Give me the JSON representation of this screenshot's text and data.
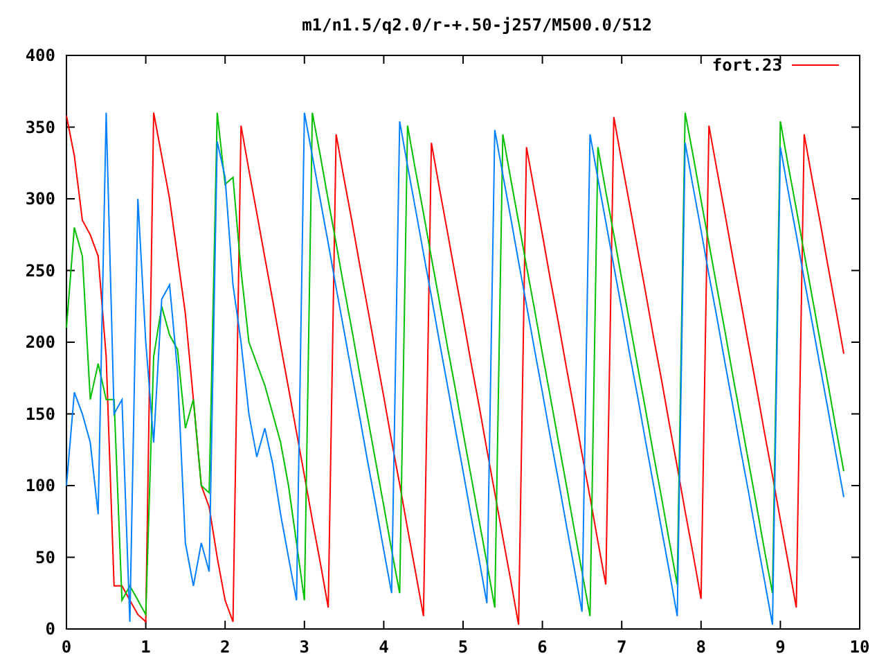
{
  "chart_data": {
    "type": "line",
    "title": "m1/n1.5/q2.0/r-+.50-j257/M500.0/512",
    "xlim": [
      0,
      10
    ],
    "ylim": [
      0,
      400
    ],
    "xticks": [
      0,
      1,
      2,
      3,
      4,
      5,
      6,
      7,
      8,
      9,
      10
    ],
    "yticks": [
      0,
      50,
      100,
      150,
      200,
      250,
      300,
      350,
      400
    ],
    "x": [
      0,
      0.1,
      0.2,
      0.3,
      0.4,
      0.5,
      0.6,
      0.7,
      0.8,
      0.9,
      1,
      1.1,
      1.2,
      1.3,
      1.4,
      1.5,
      1.6,
      1.7,
      1.8,
      1.9,
      2,
      2.1,
      2.2,
      2.3,
      2.4,
      2.5,
      2.6,
      2.7,
      2.8,
      2.9,
      3,
      3.1,
      3.2,
      3.3,
      3.4,
      3.5,
      3.6,
      3.7,
      3.8,
      3.9,
      4,
      4.1,
      4.2,
      4.3,
      4.4,
      4.5,
      4.6,
      4.7,
      4.8,
      4.9,
      5,
      5.1,
      5.2,
      5.3,
      5.4,
      5.5,
      5.6,
      5.7,
      5.8,
      5.9,
      6,
      6.1,
      6.2,
      6.3,
      6.4,
      6.5,
      6.6,
      6.7,
      6.8,
      6.9,
      7,
      7.1,
      7.2,
      7.3,
      7.4,
      7.5,
      7.6,
      7.7,
      7.8,
      7.9,
      8,
      8.1,
      8.2,
      8.3,
      8.4,
      8.5,
      8.6,
      8.7,
      8.8,
      8.9,
      9,
      9.1,
      9.2,
      9.3,
      9.4,
      9.5,
      9.6,
      9.7,
      9.8
    ],
    "series": [
      {
        "name": "fort.23",
        "color": "#ff0000",
        "values": [
          358,
          330,
          285,
          275,
          260,
          190,
          30,
          30,
          20,
          10,
          5,
          360,
          330,
          300,
          260,
          220,
          160,
          100,
          85,
          50,
          20,
          5,
          351,
          320,
          290,
          259,
          229,
          198,
          168,
          137,
          107,
          76,
          46,
          15,
          345,
          314,
          284,
          253,
          223,
          192,
          162,
          131,
          101,
          70,
          40,
          9,
          339,
          308,
          278,
          247,
          217,
          186,
          156,
          125,
          95,
          64,
          34,
          3,
          336,
          305,
          275,
          244,
          214,
          183,
          153,
          122,
          92,
          61,
          31,
          357,
          326,
          296,
          265,
          235,
          204,
          174,
          143,
          113,
          82,
          52,
          21,
          351,
          320,
          290,
          259,
          229,
          198,
          168,
          137,
          107,
          76,
          46,
          15,
          345,
          314,
          284,
          253,
          223,
          192
        ]
      },
      {
        "color": "#00c000",
        "values": [
          210,
          280,
          260,
          160,
          185,
          160,
          160,
          20,
          30,
          20,
          10,
          190,
          225,
          205,
          195,
          140,
          160,
          100,
          95,
          360,
          310,
          315,
          250,
          200,
          185,
          170,
          150,
          130,
          100,
          60,
          20,
          360,
          330,
          299,
          269,
          238,
          208,
          177,
          147,
          116,
          86,
          55,
          25,
          351,
          320,
          290,
          259,
          229,
          198,
          168,
          137,
          107,
          76,
          46,
          15,
          345,
          314,
          284,
          253,
          223,
          192,
          162,
          131,
          101,
          70,
          40,
          9,
          336,
          305,
          275,
          244,
          214,
          183,
          153,
          122,
          92,
          61,
          31,
          360,
          330,
          299,
          269,
          238,
          208,
          177,
          147,
          116,
          86,
          55,
          25,
          354,
          323,
          293,
          262,
          232,
          201,
          171,
          140,
          110
        ]
      },
      {
        "color": "#0080ff",
        "values": [
          100,
          165,
          150,
          130,
          80,
          360,
          150,
          160,
          5,
          300,
          200,
          130,
          230,
          240,
          180,
          60,
          30,
          60,
          40,
          340,
          315,
          240,
          200,
          150,
          120,
          140,
          115,
          80,
          50,
          20,
          360,
          330,
          299,
          269,
          238,
          208,
          177,
          147,
          116,
          86,
          55,
          25,
          354,
          323,
          293,
          262,
          232,
          201,
          171,
          140,
          110,
          79,
          49,
          18,
          348,
          317,
          287,
          256,
          226,
          195,
          165,
          134,
          104,
          73,
          43,
          12,
          345,
          314,
          284,
          253,
          223,
          192,
          162,
          131,
          101,
          70,
          40,
          9,
          339,
          308,
          278,
          247,
          217,
          186,
          156,
          125,
          95,
          64,
          34,
          3,
          336,
          305,
          275,
          244,
          214,
          183,
          153,
          122,
          92
        ]
      }
    ]
  }
}
